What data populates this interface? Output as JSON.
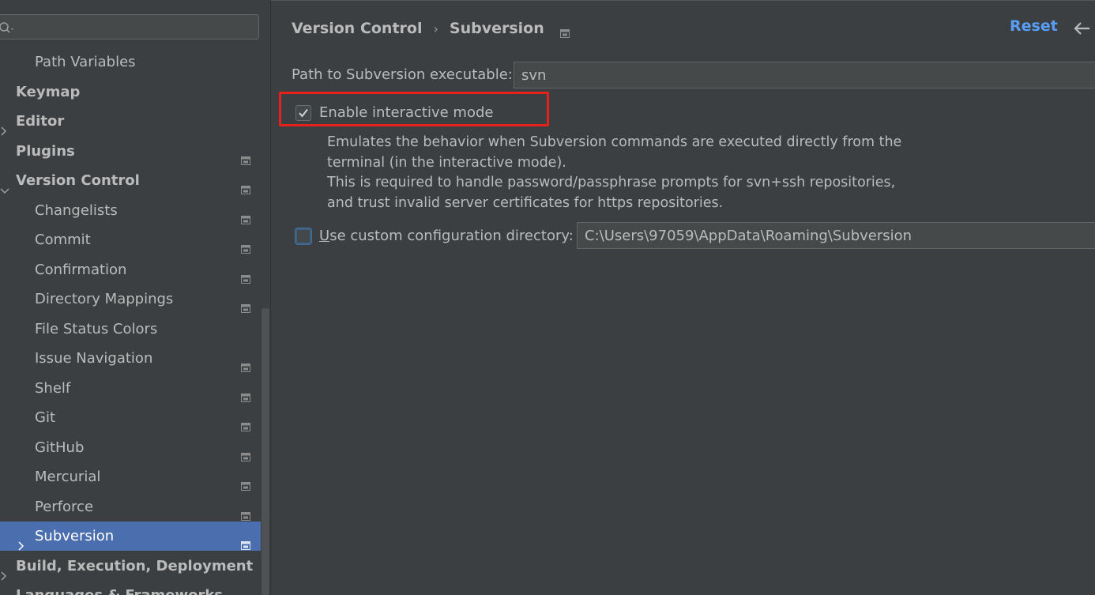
{
  "sidebar": {
    "search": {
      "placeholder": ""
    },
    "items": [
      {
        "label": "Path Variables",
        "level": 1,
        "bold": false,
        "chevron": "none",
        "project_icon": false,
        "selected": false
      },
      {
        "label": "Keymap",
        "level": 0,
        "bold": true,
        "chevron": "none",
        "project_icon": false,
        "selected": false
      },
      {
        "label": "Editor",
        "level": 0,
        "bold": true,
        "chevron": "right",
        "project_icon": false,
        "selected": false
      },
      {
        "label": "Plugins",
        "level": 0,
        "bold": true,
        "chevron": "none",
        "project_icon": true,
        "selected": false
      },
      {
        "label": "Version Control",
        "level": 0,
        "bold": true,
        "chevron": "down",
        "project_icon": true,
        "selected": false
      },
      {
        "label": "Changelists",
        "level": 1,
        "bold": false,
        "chevron": "none",
        "project_icon": true,
        "selected": false
      },
      {
        "label": "Commit",
        "level": 1,
        "bold": false,
        "chevron": "none",
        "project_icon": true,
        "selected": false
      },
      {
        "label": "Confirmation",
        "level": 1,
        "bold": false,
        "chevron": "none",
        "project_icon": true,
        "selected": false
      },
      {
        "label": "Directory Mappings",
        "level": 1,
        "bold": false,
        "chevron": "none",
        "project_icon": true,
        "selected": false
      },
      {
        "label": "File Status Colors",
        "level": 1,
        "bold": false,
        "chevron": "none",
        "project_icon": false,
        "selected": false
      },
      {
        "label": "Issue Navigation",
        "level": 1,
        "bold": false,
        "chevron": "none",
        "project_icon": true,
        "selected": false
      },
      {
        "label": "Shelf",
        "level": 1,
        "bold": false,
        "chevron": "none",
        "project_icon": true,
        "selected": false
      },
      {
        "label": "Git",
        "level": 1,
        "bold": false,
        "chevron": "none",
        "project_icon": true,
        "selected": false
      },
      {
        "label": "GitHub",
        "level": 1,
        "bold": false,
        "chevron": "none",
        "project_icon": true,
        "selected": false
      },
      {
        "label": "Mercurial",
        "level": 1,
        "bold": false,
        "chevron": "none",
        "project_icon": true,
        "selected": false
      },
      {
        "label": "Perforce",
        "level": 1,
        "bold": false,
        "chevron": "none",
        "project_icon": true,
        "selected": false
      },
      {
        "label": "Subversion",
        "level": 1,
        "bold": false,
        "chevron": "right",
        "project_icon": true,
        "selected": true
      },
      {
        "label": "Build, Execution, Deployment",
        "level": 0,
        "bold": true,
        "chevron": "right",
        "project_icon": false,
        "selected": false
      },
      {
        "label": "Languages & Frameworks",
        "level": 0,
        "bold": true,
        "chevron": "right",
        "project_icon": false,
        "selected": false
      }
    ]
  },
  "header": {
    "breadcrumb": {
      "parent": "Version Control",
      "separator": "›",
      "current": "Subversion"
    },
    "reset_label": "Reset"
  },
  "settings": {
    "executable": {
      "label": "Path to Subversion executable:",
      "value": "svn"
    },
    "interactive_mode": {
      "label": "Enable interactive mode",
      "checked": true,
      "description": [
        "Emulates the behavior when Subversion commands are executed directly from the",
        "terminal (in the interactive mode).",
        "This is required to handle password/passphrase prompts for svn+ssh repositories,",
        "and trust invalid server certificates for https repositories."
      ]
    },
    "custom_config": {
      "label_mnemonic": "U",
      "label_rest": "se custom configuration directory:",
      "checked": false,
      "value": "C:\\Users\\97059\\AppData\\Roaming\\Subversion"
    }
  },
  "colors": {
    "background": "#3c3f41",
    "selection": "#4b6eaf",
    "link": "#589df6",
    "highlight": "#e8201a",
    "text": "#bbbbbb"
  }
}
